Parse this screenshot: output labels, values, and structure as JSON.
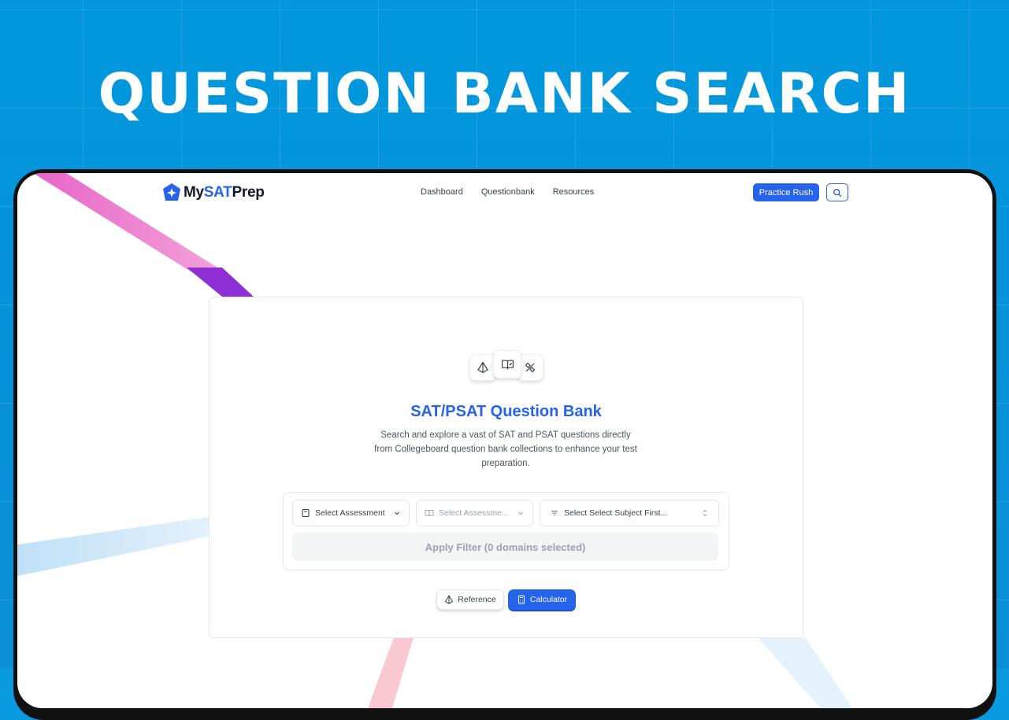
{
  "banner": {
    "headline": "QUESTION BANK SEARCH"
  },
  "nav": {
    "logo_prefix": "My",
    "logo_accent": "SAT",
    "logo_suffix": "Prep",
    "links": [
      "Dashboard",
      "Questionbank",
      "Resources"
    ],
    "practice_button": "Practice Rush",
    "search_icon": "search-icon"
  },
  "card": {
    "icons": [
      "pyramid-icon",
      "book-check-icon",
      "tools-icon"
    ],
    "title": "SAT/PSAT Question Bank",
    "description": "Search and explore a vast of SAT and PSAT questions directly from Collegeboard question bank collections to enhance your test preparation.",
    "filters": {
      "assessment": {
        "icon": "notebook-icon",
        "label": "Select Assessment"
      },
      "subject": {
        "icon": "book-open-icon",
        "label": "Select Assessme..."
      },
      "domain": {
        "icon": "filter-icon",
        "label": "Select Select Subject First..."
      },
      "apply_label": "Apply Filter (0 domains selected)"
    },
    "buttons": {
      "reference": "Reference",
      "calculator": "Calculator"
    }
  },
  "colors": {
    "brand": "#2563eb",
    "background": "#0a9ae0",
    "title": "#2563eb"
  }
}
